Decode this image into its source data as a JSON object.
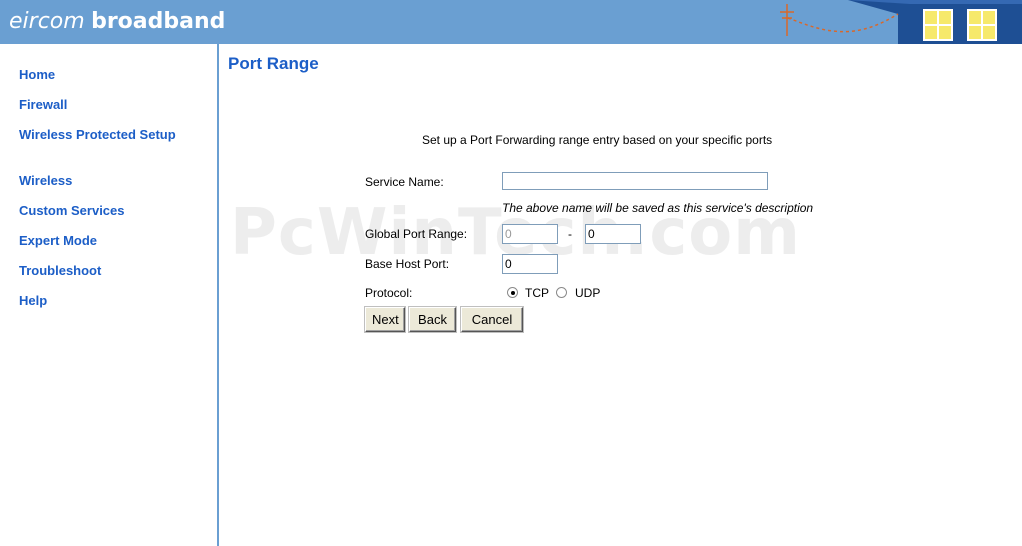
{
  "brand": {
    "part1": "eircom",
    "part2": "broadband"
  },
  "sidebar": {
    "items": [
      {
        "label": "Home"
      },
      {
        "label": "Firewall"
      },
      {
        "label": "Wireless Protected Setup"
      },
      {
        "label": "Wireless"
      },
      {
        "label": "Custom Services"
      },
      {
        "label": "Expert Mode"
      },
      {
        "label": "Troubleshoot"
      },
      {
        "label": "Help"
      }
    ]
  },
  "main": {
    "title": "Port Range",
    "intro": "Set up a Port Forwarding range entry based on your specific ports",
    "form": {
      "service_name_label": "Service Name:",
      "service_name_value": "",
      "note": "The above name will be saved as this service's description",
      "global_port_range_label": "Global Port Range:",
      "global_port_start": "0",
      "range_separator": "-",
      "global_port_end": "0",
      "base_host_port_label": "Base Host Port:",
      "base_host_port_value": "0",
      "protocol_label": "Protocol:",
      "protocol_options": [
        "TCP",
        "UDP"
      ],
      "protocol_selected": "TCP"
    },
    "buttons": {
      "next": "Next",
      "back": "Back",
      "cancel": "Cancel"
    }
  },
  "watermark": "PcWinTech.com",
  "colors": {
    "header": "#6a9fd2",
    "link": "#1c5ec7",
    "title": "#1c5ec7"
  },
  "icons": {
    "header_decoration": "house-windows-icon"
  }
}
